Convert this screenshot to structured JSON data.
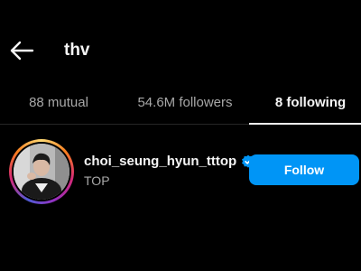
{
  "header": {
    "back_icon": "arrow-left-icon",
    "title": "thv"
  },
  "tabs": [
    {
      "label": "88 mutual",
      "active": false
    },
    {
      "label": "54.6M followers",
      "active": false
    },
    {
      "label": "8 following",
      "active": true
    }
  ],
  "accounts": [
    {
      "username": "choi_seung_hyun_tttop",
      "verified": true,
      "verified_icon": "verified-badge-icon",
      "full_name": "TOP",
      "follow_label": "Follow",
      "has_story_ring": true
    }
  ],
  "colors": {
    "background": "#000000",
    "text_primary": "#f5f5f5",
    "text_secondary": "#a8a8a8",
    "follow_button": "#0095f6",
    "verified": "#0095f6"
  }
}
